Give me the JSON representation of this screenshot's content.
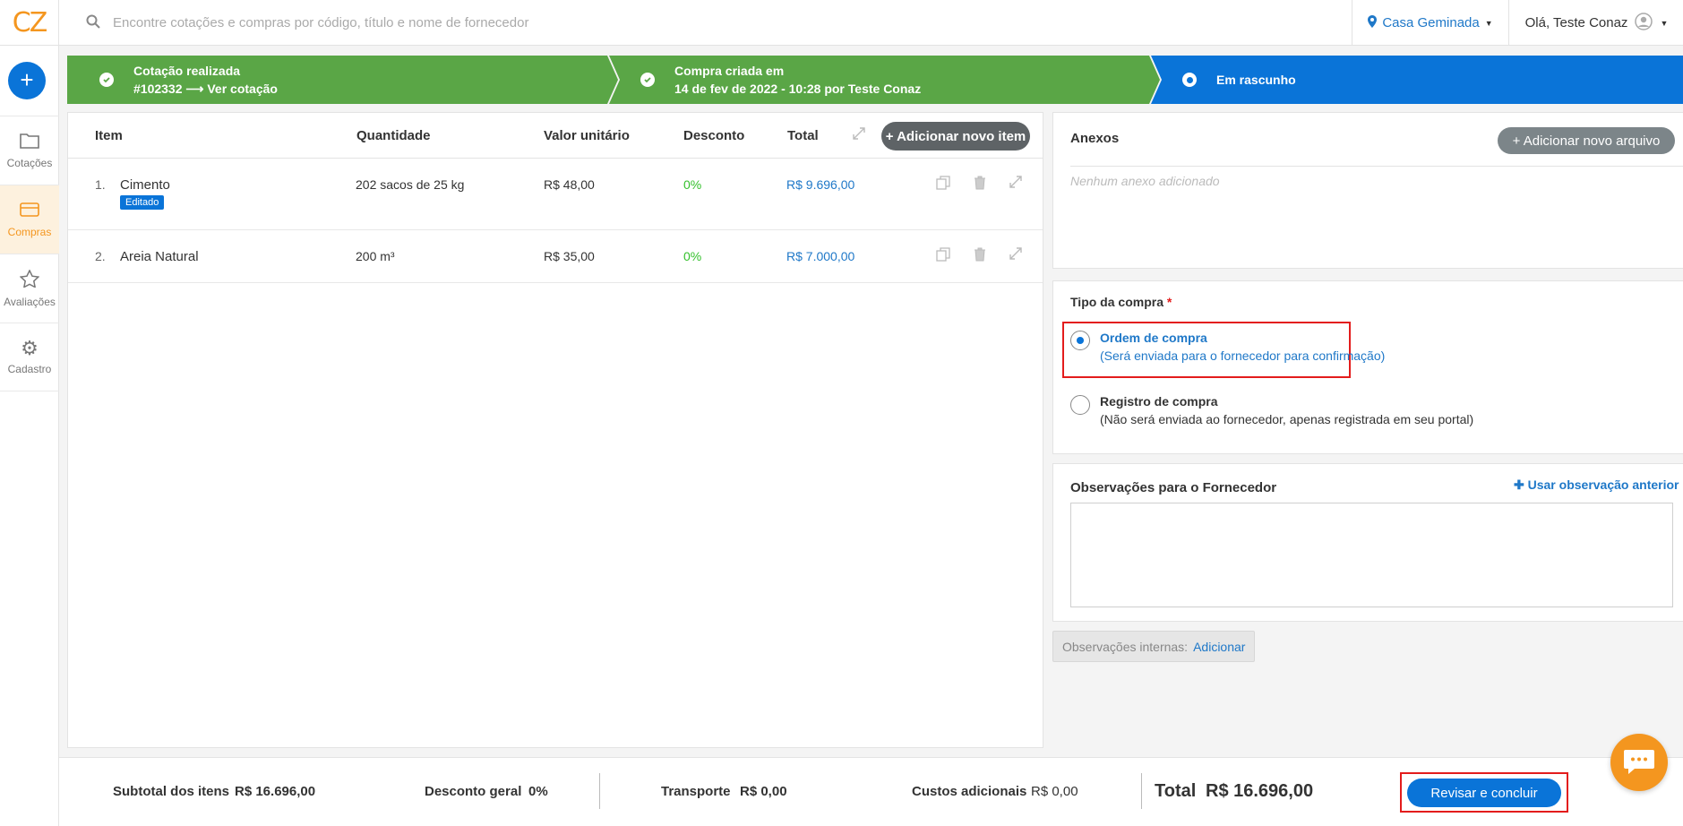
{
  "brand": {
    "logo": "CZ",
    "accent": "#f4961f",
    "primary": "#0a74d8",
    "success": "#5aa646"
  },
  "search": {
    "placeholder": "Encontre cotações e compras por código, título e nome de fornecedor",
    "icon": "search-icon"
  },
  "location": {
    "label": "Casa Geminada",
    "icon": "map-pin-icon"
  },
  "user": {
    "greeting": "Olá, Teste Conaz",
    "icon": "user-avatar-icon"
  },
  "sidebar": {
    "add": "+",
    "items": [
      {
        "label": "Cotações",
        "icon": "folder-icon",
        "active": false
      },
      {
        "label": "Compras",
        "icon": "card-icon",
        "active": true
      },
      {
        "label": "Avaliações",
        "icon": "star-icon",
        "active": false
      },
      {
        "label": "Cadastro",
        "icon": "gear-icon",
        "active": false
      }
    ]
  },
  "stepper": {
    "steps": [
      {
        "line1": "Cotação realizada",
        "line2": "#102332 ⟶ Ver cotação",
        "status": "done"
      },
      {
        "line1": "Compra criada em",
        "line2": "14 de fev de 2022 - 10:28 por Teste Conaz",
        "status": "done"
      },
      {
        "line1": "Em rascunho",
        "line2": "",
        "status": "current"
      }
    ]
  },
  "items_table": {
    "headers": {
      "item": "Item",
      "quantity": "Quantidade",
      "unit_price": "Valor unitário",
      "discount": "Desconto",
      "total": "Total"
    },
    "add_button": "+ Adicionar novo item",
    "rows": [
      {
        "index": "1.",
        "name": "Cimento",
        "badge": "Editado",
        "quantity": "202 sacos de 25 kg",
        "unit_price": "R$ 48,00",
        "discount": "0%",
        "total": "R$ 9.696,00"
      },
      {
        "index": "2.",
        "name": "Areia Natural",
        "badge": "",
        "quantity": "200 m³",
        "unit_price": "R$ 35,00",
        "discount": "0%",
        "total": "R$ 7.000,00"
      }
    ]
  },
  "attachments": {
    "title": "Anexos",
    "add_button": "+ Adicionar novo arquivo",
    "empty": "Nenhum anexo adicionado"
  },
  "purchase_type": {
    "title": "Tipo da compra",
    "required": "*",
    "options": [
      {
        "title": "Ordem de compra",
        "subtitle": "(Será enviada para o fornecedor para confirmação)",
        "selected": true
      },
      {
        "title": "Registro de compra",
        "subtitle": "(Não será enviada ao fornecedor, apenas registrada em seu portal)",
        "selected": false
      }
    ]
  },
  "supplier_notes": {
    "title": "Observações para o Fornecedor",
    "use_previous": "Usar observação anterior"
  },
  "internal_notes": {
    "label": "Observações internas:",
    "action": "Adicionar"
  },
  "footer": {
    "subtotal_label": "Subtotal dos itens",
    "subtotal_value": "R$ 16.696,00",
    "discount_label": "Desconto geral",
    "discount_value": "0%",
    "transport_label": "Transporte",
    "transport_value": "R$ 0,00",
    "extra_label": "Custos adicionais",
    "extra_value": "R$ 0,00",
    "total_label": "Total",
    "total_value": "R$ 16.696,00",
    "cta": "Revisar e concluir"
  }
}
